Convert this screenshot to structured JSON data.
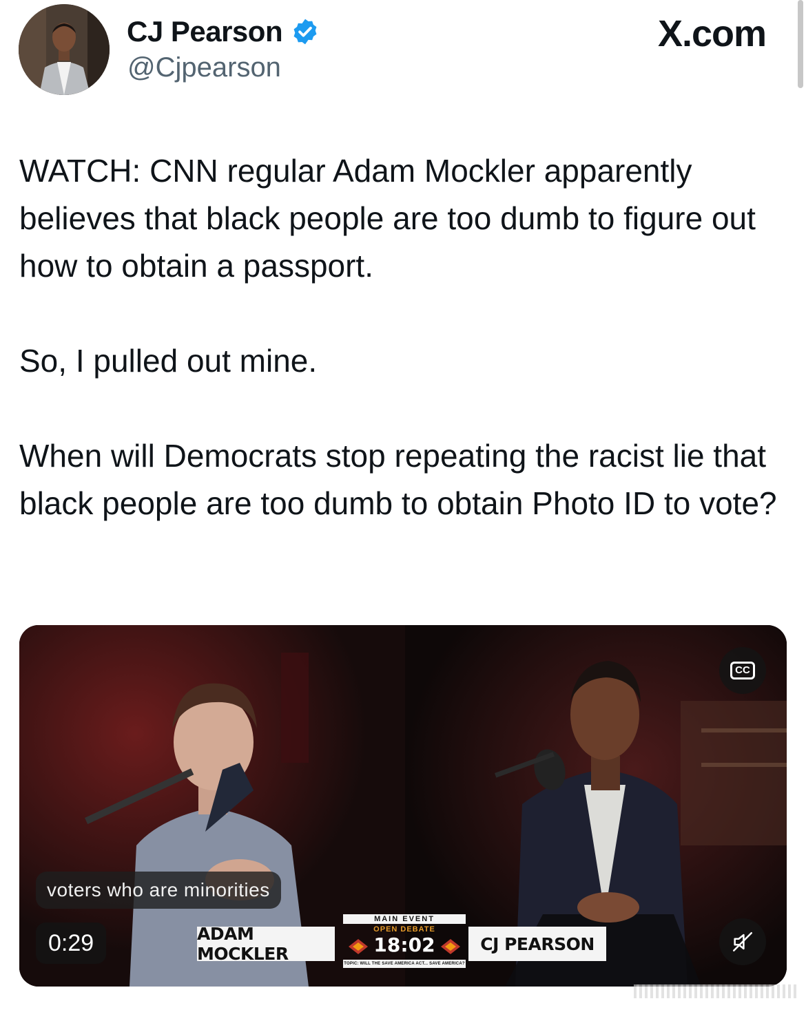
{
  "header": {
    "display_name": "CJ Pearson",
    "handle": "@Cjpearson",
    "brand": "X.com",
    "verified": true,
    "verified_color": "#1d9bf0"
  },
  "tweet": {
    "paragraphs": [
      "WATCH: CNN regular Adam Mockler apparently believes that black people are too dumb to figure out how to obtain a passport.",
      "So, I pulled out mine.",
      "When will Democrats stop repeating the racist lie that black people are too dumb to obtain Photo ID to vote?"
    ]
  },
  "video": {
    "caption": "voters who are minorities",
    "elapsed": "0:29",
    "cc_label": "CC",
    "muted": true,
    "lower_third": {
      "left_name": "ADAM MOCKLER",
      "right_name": "CJ PEARSON",
      "event_title": "MAIN EVENT",
      "event_subtitle": "OPEN DEBATE",
      "clock": "18:02",
      "topic": "TOPIC: WILL THE SAVE AMERICA ACT... SAVE AMERICA?"
    }
  },
  "icons": {
    "verified": "verified-badge-icon",
    "cc": "closed-captions-icon",
    "mute": "speaker-muted-icon"
  }
}
